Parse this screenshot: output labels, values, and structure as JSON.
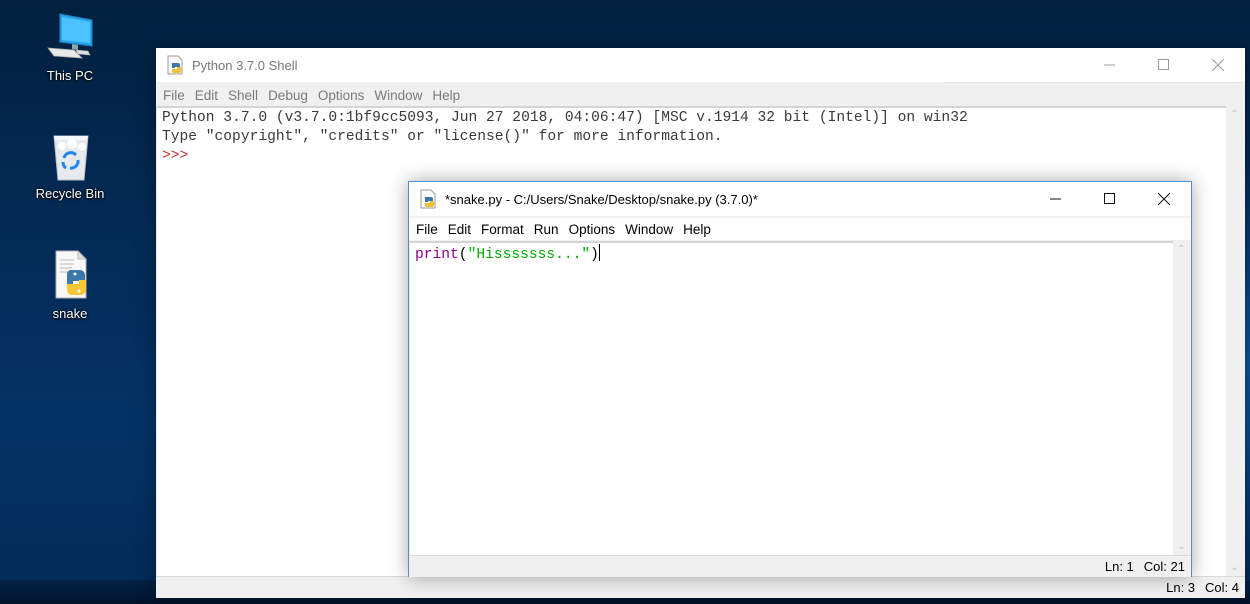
{
  "desktop": {
    "icons": [
      {
        "label": "This PC",
        "icon": "computer-icon"
      },
      {
        "label": "Recycle Bin",
        "icon": "recycle-bin-icon"
      },
      {
        "label": "snake",
        "icon": "python-file-icon"
      }
    ]
  },
  "shell_window": {
    "title": "Python 3.7.0 Shell",
    "menu": [
      "File",
      "Edit",
      "Shell",
      "Debug",
      "Options",
      "Window",
      "Help"
    ],
    "lines": [
      "Python 3.7.0 (v3.7.0:1bf9cc5093, Jun 27 2018, 04:06:47) [MSC v.1914 32 bit (Intel)] on win32",
      "Type \"copyright\", \"credits\" or \"license()\" for more information."
    ],
    "prompt": ">>>",
    "status": {
      "line": "Ln: 3",
      "col": "Col: 4"
    },
    "controls": {
      "minimize": "minimize",
      "maximize": "maximize",
      "close": "close"
    }
  },
  "editor_window": {
    "title": "*snake.py - C:/Users/Snake/Desktop/snake.py (3.7.0)*",
    "menu": [
      "File",
      "Edit",
      "Format",
      "Run",
      "Options",
      "Window",
      "Help"
    ],
    "code": {
      "builtin": "print",
      "open_paren": "(",
      "string": "\"Hisssssss...\"",
      "close_paren": ")"
    },
    "status": {
      "line": "Ln: 1",
      "col": "Col: 21"
    },
    "colors": {
      "builtin": "#900090",
      "string": "#00aa00",
      "prompt": "#c03030"
    }
  }
}
